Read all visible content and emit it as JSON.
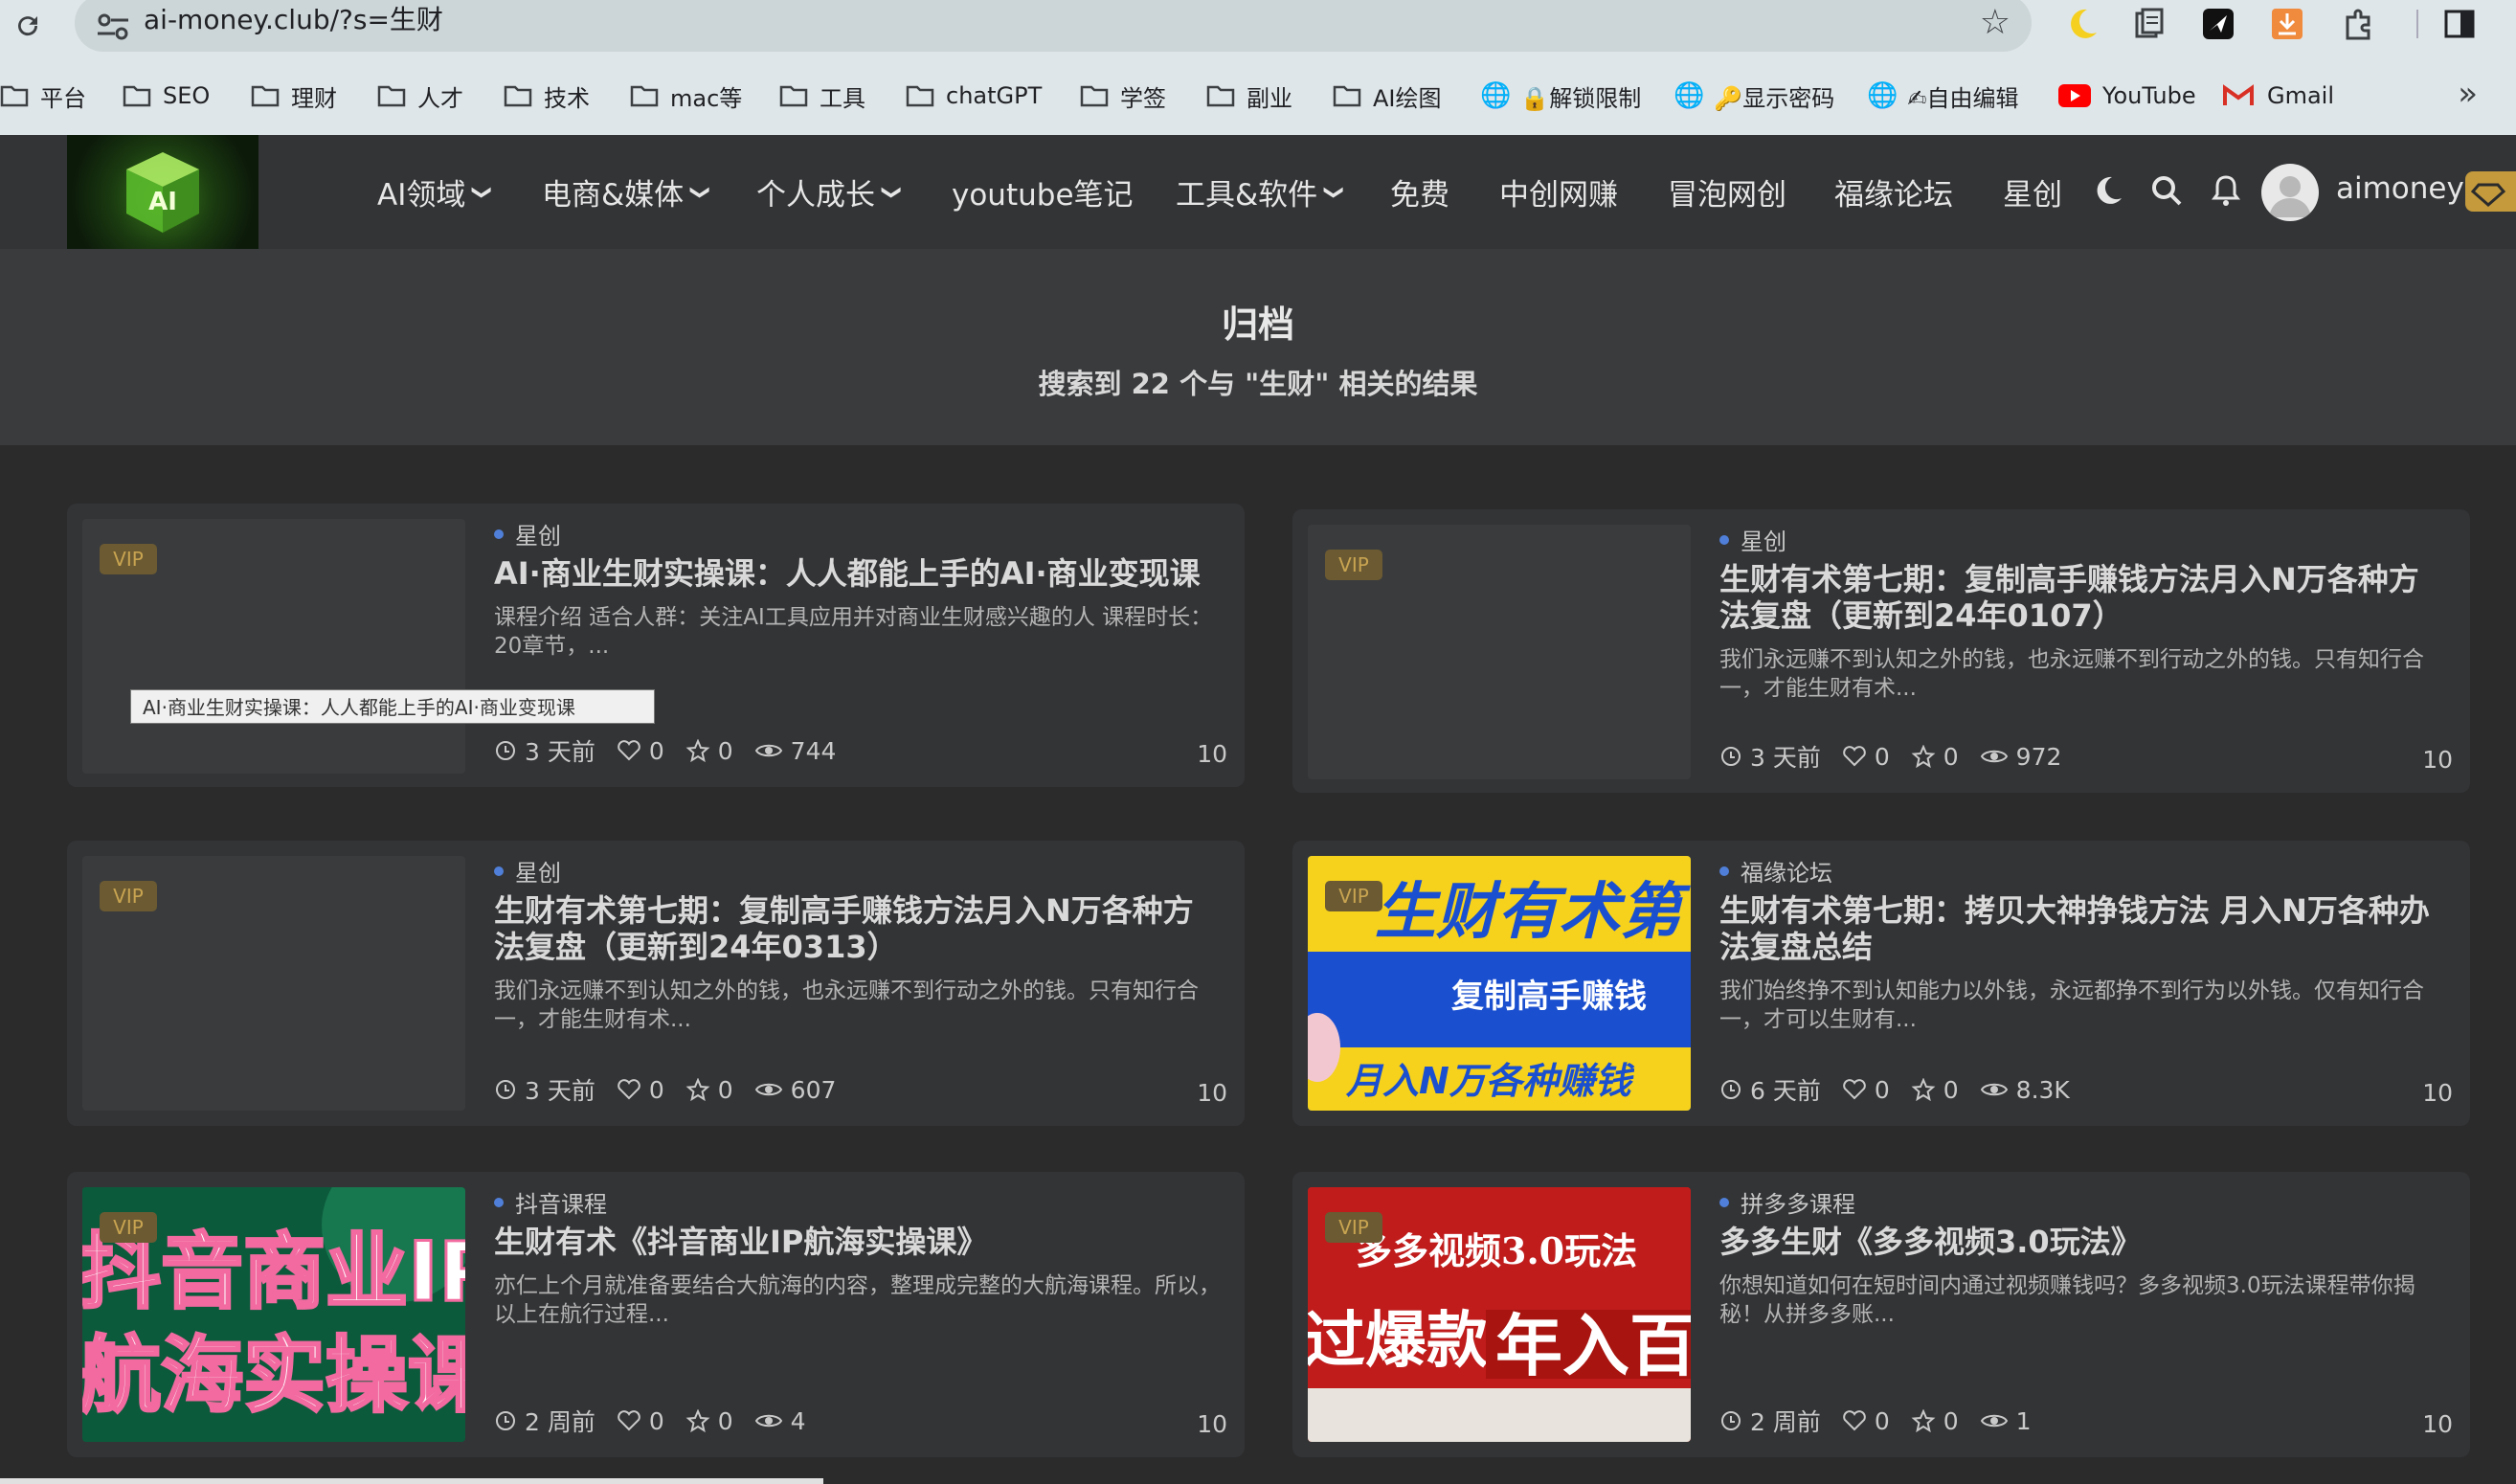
{
  "browser": {
    "url": "ai-money.club/?s=生财",
    "bookmarks": [
      "平台",
      "SEO",
      "理财",
      "人才",
      "技术",
      "mac等",
      "工具",
      "chatGPT",
      "学签",
      "副业",
      "AI绘图"
    ],
    "bookmark_links": [
      {
        "label": "🔒解锁限制",
        "icon": "globe-icon"
      },
      {
        "label": "🔑显示密码",
        "icon": "globe-icon"
      },
      {
        "label": "✍自由编辑",
        "icon": "globe-icon"
      },
      {
        "label": "YouTube",
        "icon": "youtube-icon"
      },
      {
        "label": "Gmail",
        "icon": "gmail-icon"
      }
    ],
    "more": "»"
  },
  "site": {
    "logo_text": "AI",
    "nav": [
      {
        "label": "AI领域",
        "dropdown": true
      },
      {
        "label": "电商&媒体",
        "dropdown": true
      },
      {
        "label": "个人成长",
        "dropdown": true
      },
      {
        "label": "youtube笔记",
        "dropdown": false
      },
      {
        "label": "工具&软件",
        "dropdown": true
      },
      {
        "label": "免费",
        "dropdown": false
      },
      {
        "label": "中创网赚",
        "dropdown": false
      },
      {
        "label": "冒泡网创",
        "dropdown": false
      },
      {
        "label": "福缘论坛",
        "dropdown": false
      },
      {
        "label": "星创",
        "dropdown": false
      }
    ],
    "username": "aimoney",
    "accent": "#c49a3c"
  },
  "archive": {
    "title": "归档",
    "subtitle": "搜索到 22 个与 \"生财\" 相关的结果"
  },
  "posts": [
    {
      "vip": "VIP",
      "category": "星创",
      "title": "AI·商业生财实操课：人人都能上手的AI·商业变现课",
      "excerpt": "课程介绍 适合人群：关注AI工具应用并对商业生财感兴趣的人 课程时长：20章节，...",
      "time": "3 天前",
      "likes": "0",
      "favs": "0",
      "views": "744",
      "points": "10"
    },
    {
      "vip": "VIP",
      "category": "星创",
      "title": "生财有术第七期：复制高手赚钱方法月入N万各种方法复盘（更新到24年0107）",
      "excerpt": "我们永远赚不到认知之外的钱，也永远赚不到行动之外的钱。只有知行合一，才能生财有术...",
      "time": "3 天前",
      "likes": "0",
      "favs": "0",
      "views": "972",
      "points": "10"
    },
    {
      "vip": "VIP",
      "category": "星创",
      "title": "生财有术第七期：复制高手赚钱方法月入N万各种方法复盘（更新到24年0313）",
      "excerpt": "我们永远赚不到认知之外的钱，也永远赚不到行动之外的钱。只有知行合一，才能生财有术...",
      "time": "3 天前",
      "likes": "0",
      "favs": "0",
      "views": "607",
      "points": "10"
    },
    {
      "vip": "VIP",
      "category": "福缘论坛",
      "title": "生财有术第七期：拷贝大神挣钱方法 月入N万各种办法复盘总结",
      "excerpt": "我们始终挣不到认知能力以外钱，永远都挣不到行为以外钱。仅有知行合一，才可以生财有...",
      "time": "6 天前",
      "likes": "0",
      "favs": "0",
      "views": "8.3K",
      "points": "10",
      "thumb_lines": [
        "生财有术第",
        "复制高手赚钱",
        "月入N万各种赚钱"
      ]
    },
    {
      "vip": "VIP",
      "category": "抖音课程",
      "title": "生财有术《抖音商业IP航海实操课》",
      "excerpt": "亦仁上个月就准备要结合大航海的内容，整理成完整的大航海课程。所以，以上在航行过程...",
      "time": "2 周前",
      "likes": "0",
      "favs": "0",
      "views": "4",
      "points": "10",
      "thumb_lines": [
        "抖音商业IP",
        "航海实操课"
      ]
    },
    {
      "vip": "VIP",
      "category": "拼多多课程",
      "title": "多多生财《多多视频3.0玩法》",
      "excerpt": "你想知道如何在短时间内通过视频赚钱吗？多多视频3.0玩法课程带你揭秘！从拼多多账...",
      "time": "2 周前",
      "likes": "0",
      "favs": "0",
      "views": "1",
      "points": "10",
      "thumb_lines": [
        "多多视频3.0玩法",
        "过爆款",
        "年入百"
      ]
    }
  ],
  "tooltip": "AI·商业生财实操课：人人都能上手的AI·商业变现课"
}
